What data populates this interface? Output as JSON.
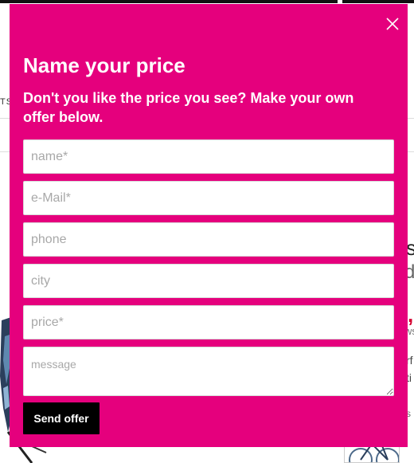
{
  "colors": {
    "modal_background": "#e5007d",
    "button_background": "#000000",
    "text_on_modal": "#ffffff",
    "accent_background_price": "#d40030"
  },
  "background_page": {
    "nav_fragment": "TS",
    "title_fragment": "s",
    "subtitle_fragment": "d",
    "price_fragment": ",",
    "meta1_fragment": "ws",
    "meta2_fragment": "rf",
    "meta3_fragment": "ti",
    "meta4_fragment": "s"
  },
  "modal": {
    "close_icon": "close-x-icon",
    "title": "Name your price",
    "subtitle": "Don't you like the price you see? Make your own offer below.",
    "fields": {
      "name": {
        "placeholder": "name*",
        "value": ""
      },
      "email": {
        "placeholder": "e-Mail*",
        "value": ""
      },
      "phone": {
        "placeholder": "phone",
        "value": ""
      },
      "city": {
        "placeholder": "city",
        "value": ""
      },
      "price": {
        "placeholder": "price*",
        "value": ""
      },
      "message": {
        "placeholder": "message",
        "value": ""
      }
    },
    "submit_label": "Send offer"
  }
}
